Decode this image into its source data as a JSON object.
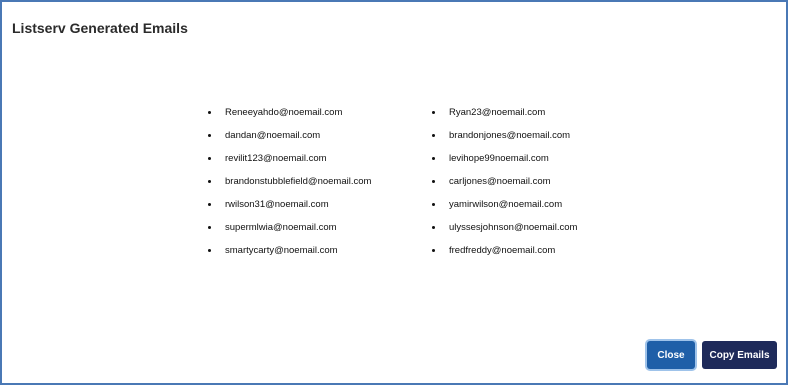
{
  "dialog": {
    "title": "Listserv Generated Emails"
  },
  "emails": {
    "left": [
      "Reneeyahdo@noemail.com",
      "dandan@noemail.com",
      "revilit123@noemail.com",
      "brandonstubblefield@noemail.com",
      "rwilson31@noemail.com",
      "supermlwia@noemail.com",
      "smartycarty@noemail.com"
    ],
    "right": [
      "Ryan23@noemail.com",
      "brandonjones@noemail.com",
      "levihope99noemail.com",
      "carljones@noemail.com",
      "yamirwilson@noemail.com",
      "ulyssesjohnson@noemail.com",
      "fredfreddy@noemail.com"
    ]
  },
  "buttons": {
    "close_label": "Close",
    "copy_label": "Copy Emails"
  },
  "colors": {
    "border": "#4a78b5",
    "close_bg": "#1f5fa8",
    "copy_bg": "#1e2a5a"
  }
}
